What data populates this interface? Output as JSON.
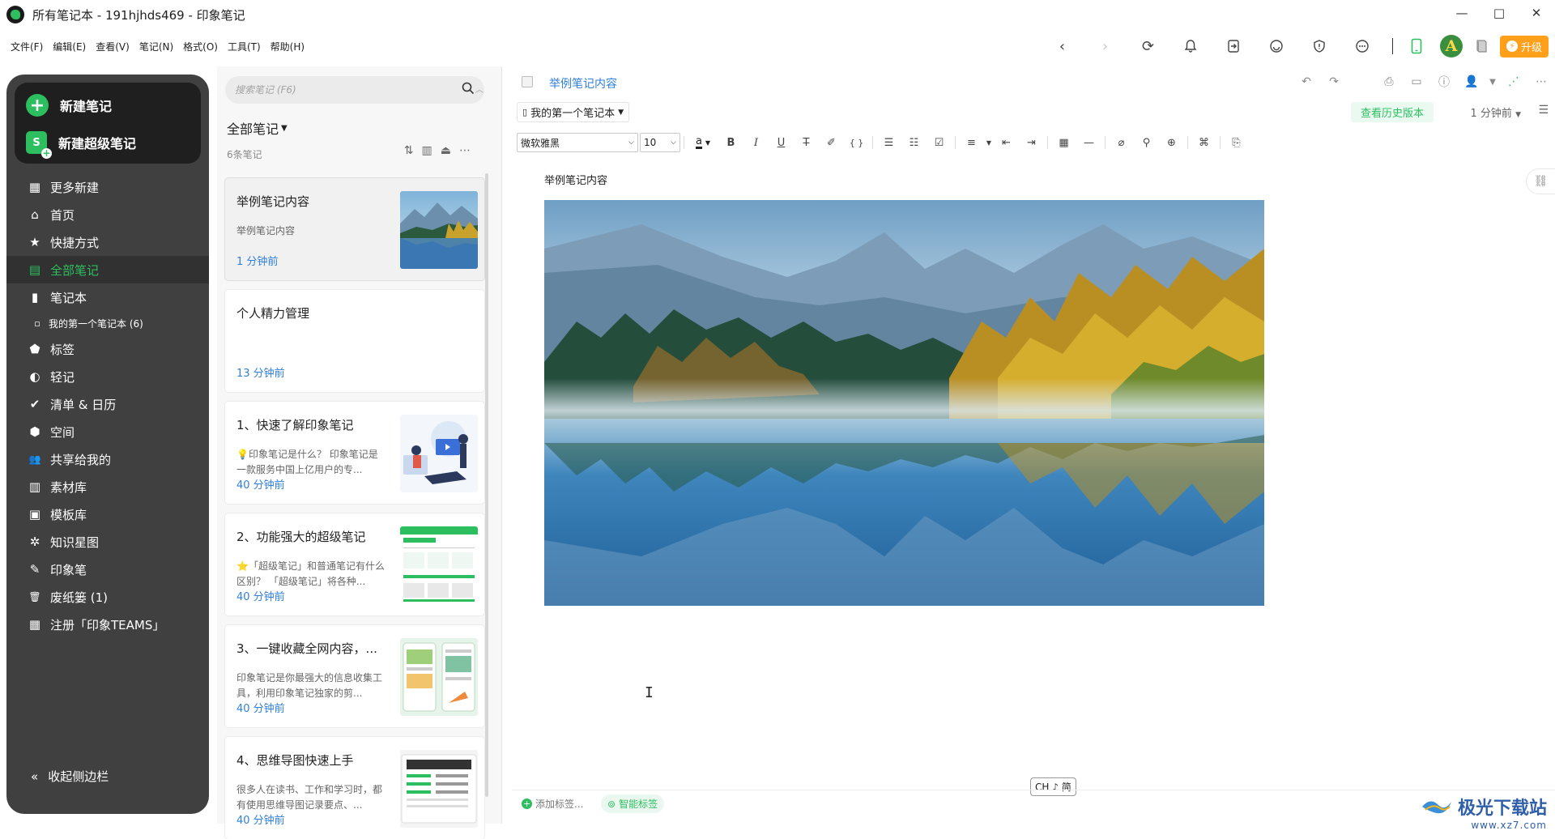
{
  "window": {
    "title": "所有笔记本 - 191hjhds469 - 印象笔记",
    "controls": [
      "—",
      "□",
      "✕"
    ]
  },
  "menu": [
    "文件(F)",
    "编辑(E)",
    "查看(V)",
    "笔记(N)",
    "格式(O)",
    "工具(T)",
    "帮助(H)"
  ],
  "toolbar": {
    "avatar_letter": "A",
    "upgrade_label": "升级",
    "upgrade_icon": "⚡"
  },
  "sidebar": {
    "new_note": "新建笔记",
    "new_super_note": "新建超级笔记",
    "super_badge": "S",
    "items": [
      {
        "label": "更多新建",
        "icon": "grid-icon",
        "glyph": "▦"
      },
      {
        "label": "首页",
        "icon": "home-icon",
        "glyph": "⌂"
      },
      {
        "label": "快捷方式",
        "icon": "star-icon",
        "glyph": "★"
      },
      {
        "label": "全部笔记",
        "icon": "note-icon",
        "glyph": "▤"
      },
      {
        "label": "笔记本",
        "icon": "notebook-icon",
        "glyph": "▮"
      },
      {
        "label": "我的第一个笔记本  (6)",
        "icon": "notebook-small-icon",
        "glyph": "▫"
      },
      {
        "label": "标签",
        "icon": "tag-icon",
        "glyph": "⬟"
      },
      {
        "label": "轻记",
        "icon": "quick-note-icon",
        "glyph": "◐"
      },
      {
        "label": "清单 & 日历",
        "icon": "checklist-icon",
        "glyph": "✔"
      },
      {
        "label": "空间",
        "icon": "space-icon",
        "glyph": "⬢"
      },
      {
        "label": "共享给我的",
        "icon": "shared-icon",
        "glyph": "👥"
      },
      {
        "label": "素材库",
        "icon": "library-icon",
        "glyph": "▥"
      },
      {
        "label": "模板库",
        "icon": "template-icon",
        "glyph": "▣"
      },
      {
        "label": "知识星图",
        "icon": "knowledge-graph-icon",
        "glyph": "✲"
      },
      {
        "label": "印象笔",
        "icon": "pen-icon",
        "glyph": "✎"
      },
      {
        "label": "废纸篓  (1)",
        "icon": "trash-icon",
        "glyph": "🗑"
      },
      {
        "label": "注册「印象TEAMS」",
        "icon": "building-icon",
        "glyph": "▦"
      }
    ],
    "collapse_label": "收起侧边栏"
  },
  "list": {
    "search_placeholder": "搜索笔记 (F6)",
    "title": "全部笔记",
    "count": "6条笔记",
    "notes": [
      {
        "title": "举例笔记内容",
        "snippet": "举例笔记内容",
        "time": "1 分钟前"
      },
      {
        "title": "个人精力管理",
        "snippet": "",
        "time": "13 分钟前"
      },
      {
        "title": "1、快速了解印象笔记",
        "snippet": "💡印象笔记是什么？ 印象笔记是一款服务中国上亿用户的专...",
        "time": "40 分钟前"
      },
      {
        "title": "2、功能强大的超级笔记",
        "snippet": "⭐「超级笔记」和普通笔记有什么区别？ 「超级笔记」将各种...",
        "time": "40 分钟前"
      },
      {
        "title": "3、一键收藏全网内容，...",
        "snippet": "印象笔记是你最强大的信息收集工具，利用印象笔记独家的剪...",
        "time": "40 分钟前"
      },
      {
        "title": "4、思维导图快速上手",
        "snippet": "很多人在读书、工作和学习时，都有使用思维导图记录要点、...",
        "time": "40 分钟前"
      }
    ]
  },
  "editor": {
    "breadcrumb": "举例笔记内容",
    "notebook": "我的第一个笔记本",
    "history_button": "查看历史版本",
    "edit_time": "1 分钟前",
    "font_family": "微软雅黑",
    "font_size": "10",
    "body_text": "举例笔记内容",
    "ime_indicator": "CH ♪ 简",
    "add_tag": "添加标签...",
    "smart_tag": "智能标签"
  },
  "watermark": {
    "title": "极光下载站",
    "url": "www.xz7.com"
  },
  "colors": {
    "brand_green": "#2dbe60",
    "sidebar_bg": "#404040",
    "link_blue": "#2f7fdb",
    "upgrade_orange": "#ff9f1a"
  }
}
